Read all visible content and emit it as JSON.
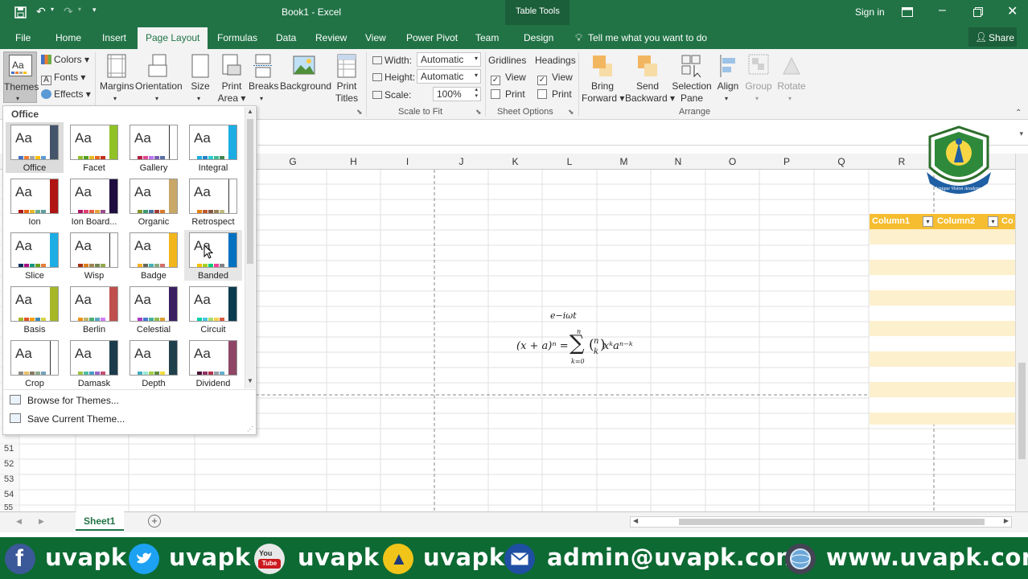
{
  "window": {
    "title": "Book1 - Excel",
    "context_tab": "Table Tools",
    "sign_in": "Sign in"
  },
  "ribbon_tabs": [
    "File",
    "Home",
    "Insert",
    "Page Layout",
    "Formulas",
    "Data",
    "Review",
    "View",
    "Power Pivot",
    "Team",
    "Design"
  ],
  "tell_me": "Tell me what you want to do",
  "share": "Share",
  "ribbon": {
    "themes": "Themes",
    "colors": "Colors",
    "fonts": "Fonts",
    "effects": "Effects",
    "margins": "Margins",
    "orientation": "Orientation",
    "size": "Size",
    "print_area_1": "Print",
    "print_area_2": "Area",
    "breaks": "Breaks",
    "background": "Background",
    "print_titles_1": "Print",
    "print_titles_2": "Titles",
    "width_label": "Width:",
    "width_value": "Automatic",
    "height_label": "Height:",
    "height_value": "Automatic",
    "scale_label": "Scale:",
    "scale_value": "100%",
    "scale_group": "Scale to Fit",
    "gridlines": "Gridlines",
    "headings": "Headings",
    "view": "View",
    "print": "Print",
    "sheet_options_group": "Sheet Options",
    "bring_forward_1": "Bring",
    "bring_forward_2": "Forward",
    "send_backward_1": "Send",
    "send_backward_2": "Backward",
    "selection_pane_1": "Selection",
    "selection_pane_2": "Pane",
    "align": "Align",
    "group": "Group",
    "rotate": "Rotate",
    "arrange_group": "Arrange"
  },
  "gallery": {
    "section": "Office",
    "themes": [
      {
        "name": "Office",
        "side": "#44546a",
        "bars": [
          "#4472c4",
          "#ed7d31",
          "#a5a5a5",
          "#ffc000",
          "#5b9bd5",
          "#70ad47"
        ]
      },
      {
        "name": "Facet",
        "side": "#90c226",
        "bars": [
          "#90c226",
          "#54a021",
          "#e6b91e",
          "#e76618",
          "#c42f1a",
          "#918655"
        ]
      },
      {
        "name": "Gallery",
        "side": "#ffffff",
        "bars": [
          "#b71e42",
          "#de478e",
          "#bc72f0",
          "#795faf",
          "#586ea6",
          "#6892a0"
        ]
      },
      {
        "name": "Integral",
        "side": "#1cade4",
        "bars": [
          "#1cade4",
          "#2683c6",
          "#27ced7",
          "#42ba97",
          "#3e8853",
          "#62a39f"
        ]
      },
      {
        "name": "Ion",
        "side": "#b01513",
        "bars": [
          "#b01513",
          "#ea6312",
          "#e6b729",
          "#6aac90",
          "#5f9c9d",
          "#9e5e9b"
        ]
      },
      {
        "name": "Ion Board...",
        "side": "#1e0d3e",
        "bars": [
          "#b31166",
          "#e33d6f",
          "#e45f3c",
          "#e9a339",
          "#9b4b8b",
          "#7b5ea7"
        ]
      },
      {
        "name": "Organic",
        "side": "#c9a767",
        "bars": [
          "#83992a",
          "#3c9770",
          "#44709d",
          "#a23c33",
          "#d97828",
          "#deb340"
        ]
      },
      {
        "name": "Retrospect",
        "side": "#ffffff",
        "bars": [
          "#e48312",
          "#bd582c",
          "#865640",
          "#9b8357",
          "#c2bc80",
          "#94a088"
        ]
      },
      {
        "name": "Slice",
        "side": "#1cade4",
        "bars": [
          "#052f61",
          "#a50e82",
          "#14967c",
          "#6a9e1f",
          "#e87d37",
          "#c62324"
        ]
      },
      {
        "name": "Wisp",
        "side": "#ffffff",
        "bars": [
          "#a53010",
          "#de7e18",
          "#9f8351",
          "#728653",
          "#92aa4c",
          "#6aac91"
        ]
      },
      {
        "name": "Badge",
        "side": "#f2b61c",
        "bars": [
          "#f8b323",
          "#656a59",
          "#46b2b5",
          "#8caa7e",
          "#d36f68",
          "#826276"
        ]
      },
      {
        "name": "Banded",
        "side": "#0070c0",
        "bars": [
          "#ffc000",
          "#a5d028",
          "#08cc78",
          "#f24099",
          "#828288",
          "#f56617"
        ]
      },
      {
        "name": "Basis",
        "side": "#a6b727",
        "bars": [
          "#a6b727",
          "#df5327",
          "#fe9e00",
          "#418ab3",
          "#d7d447",
          "#818183"
        ]
      },
      {
        "name": "Berlin",
        "side": "#c0504d",
        "bars": [
          "#f09415",
          "#c1b56b",
          "#4baf73",
          "#5aa6c0",
          "#d17df9",
          "#fa7e5c"
        ]
      },
      {
        "name": "Celestial",
        "side": "#3a1f61",
        "bars": [
          "#ac3ec1",
          "#477bd1",
          "#46b298",
          "#90ba4c",
          "#dd9d31",
          "#e25247"
        ]
      },
      {
        "name": "Circuit",
        "side": "#0a3b4f",
        "bars": [
          "#03d4a8",
          "#4ac3e3",
          "#aadb6c",
          "#f4d14d",
          "#db5c3f",
          "#9b5f9a"
        ]
      },
      {
        "name": "Crop",
        "side": "#ffffff",
        "bars": [
          "#8c8d86",
          "#e6c069",
          "#897b61",
          "#8dab8e",
          "#77a2bb",
          "#e28394"
        ]
      },
      {
        "name": "Damask",
        "side": "#1c3c4b",
        "bars": [
          "#9ec544",
          "#50bea3",
          "#4a9ccc",
          "#9a66ca",
          "#c54f71",
          "#de9c3c"
        ]
      },
      {
        "name": "Depth",
        "side": "#20404b",
        "bars": [
          "#41aebd",
          "#97e9d5",
          "#a2cf49",
          "#608f3d",
          "#f4de3a",
          "#fcb11c"
        ]
      },
      {
        "name": "Dividend",
        "side": "#8e4664",
        "bars": [
          "#4d1434",
          "#903163",
          "#b2324b",
          "#969fa7",
          "#66b1ce",
          "#40619d"
        ]
      }
    ],
    "browse": "Browse for Themes...",
    "save": "Save Current Theme..."
  },
  "columns": [
    "G",
    "H",
    "I",
    "J",
    "K",
    "L",
    "M",
    "N",
    "O",
    "P",
    "Q",
    "R"
  ],
  "rows": [
    "51",
    "52",
    "53",
    "54",
    "55"
  ],
  "table_headers": [
    "Column1",
    "Column2",
    "Co"
  ],
  "equation": {
    "top": "e−iωt",
    "main_left": "(x + a)ⁿ = ",
    "sigma": "∑",
    "sup": "n",
    "sub": "k=0",
    "binom": "(n k)",
    "main_right": " xᵏaⁿ⁻ᵏ"
  },
  "sheet_tab": "Sheet1",
  "social": {
    "handle1": "uvapk",
    "handle2": "uvapk",
    "handle3": "uvapk",
    "handle4": "uvapk",
    "email": "admin@uvapk.com",
    "site": "www.uvapk.com"
  },
  "logo_text": "Unique Vision Academy",
  "colors": {
    "excel_green": "#217346",
    "table_gold": "#f5bd2f",
    "table_band": "#fdf0cc",
    "social_green": "#0d6a33"
  }
}
